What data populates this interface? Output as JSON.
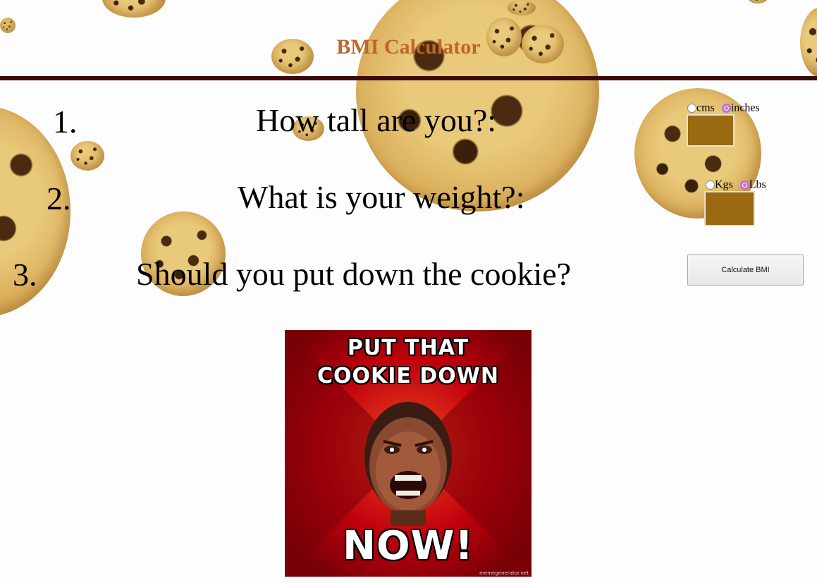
{
  "header": {
    "title": "BMI Calculator"
  },
  "questions": [
    {
      "number": "1.",
      "text": "How tall are you?:"
    },
    {
      "number": "2.",
      "text": "What is your weight?:"
    },
    {
      "number": "3.",
      "text": "Should you put down the cookie?"
    }
  ],
  "height_units": {
    "options": [
      "cms",
      "inches"
    ],
    "selected": "inches"
  },
  "weight_units": {
    "options": [
      "Kgs",
      "Lbs"
    ],
    "selected": "Lbs"
  },
  "height_input": {
    "value": ""
  },
  "weight_input": {
    "value": ""
  },
  "calculate_button": {
    "label": "Calculate BMI"
  },
  "meme": {
    "top_text_line1": "PUT THAT",
    "top_text_line2": "COOKIE DOWN",
    "bottom_text": "NOW!",
    "watermark": "memegenerator.net"
  },
  "colors": {
    "title": "#c0652a",
    "divider": "#3b0a08",
    "input_fill": "#9a6a12",
    "radio_checked": "#c470d0",
    "meme_background": "#b0000f"
  },
  "icons": {
    "cookie": "cookie-decoration-icon",
    "face": "angry-face-icon"
  }
}
